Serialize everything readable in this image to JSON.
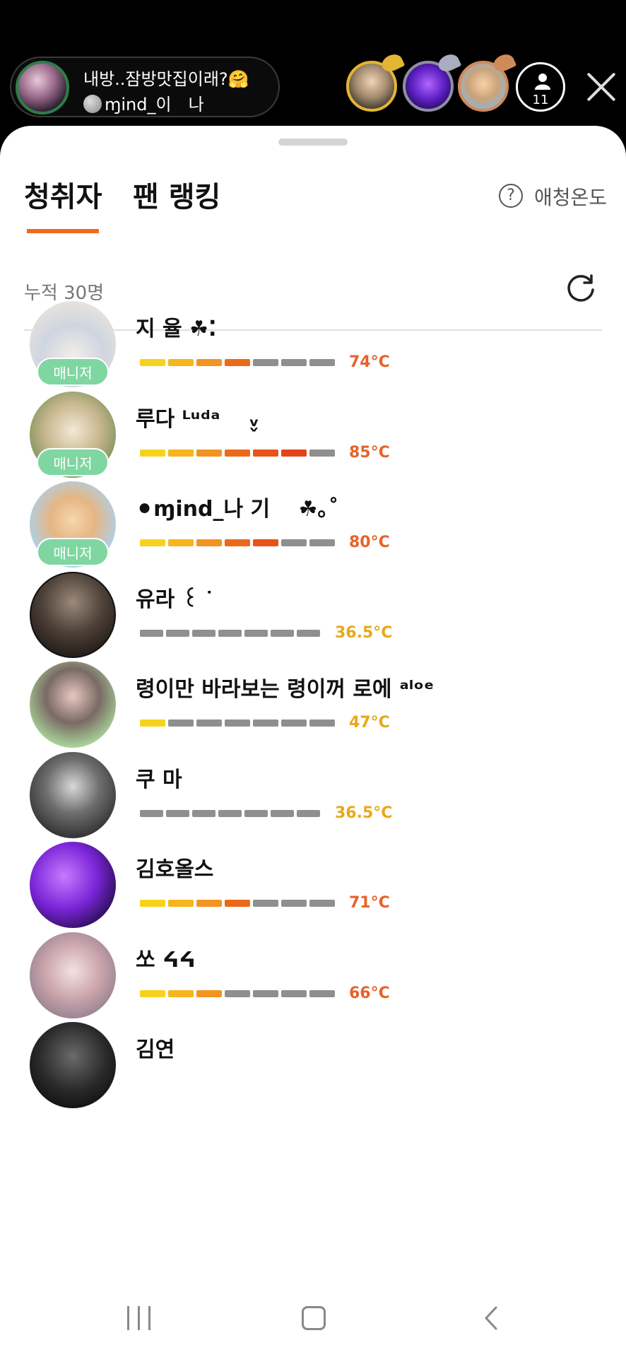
{
  "room": {
    "title": "내방..잠방맛집이래?🤗",
    "host": "ɱind_이　나"
  },
  "listener_count": "11",
  "tabs": [
    {
      "label": "청취자",
      "active": true
    },
    {
      "label": "팬 랭킹",
      "active": false
    }
  ],
  "help_label": "애청온도",
  "total_listeners": "누적 30명",
  "colors": {
    "accent": "#ee6a1d",
    "manager_badge": "#7fd6a1",
    "hot": "#e8622a",
    "warm": "#e8a81a"
  },
  "listeners": [
    {
      "name": "지 율 ☘︎⁚",
      "badge": "매니저",
      "temp": "74°C",
      "level": 0.74
    },
    {
      "name": "루다 ᴸᵘᵈᵃ　 ᵥ̬",
      "badge": "매니저",
      "temp": "85°C",
      "level": 0.85
    },
    {
      "name": "⚫ɱind_나 기　 ☘︎｡˚",
      "badge": "매니저",
      "temp": "80°C",
      "level": 0.8
    },
    {
      "name": "유라 ꒰ ᐝ",
      "badge": "",
      "temp": "36.5°C",
      "level": 0.365
    },
    {
      "name": "령이만 바라보는 령이꺼 로에 ᵃˡᵒᵉ",
      "badge": "",
      "temp": "47°C",
      "level": 0.47
    },
    {
      "name": "쿠 마",
      "badge": "",
      "temp": "36.5°C",
      "level": 0.365
    },
    {
      "name": "김호올스",
      "badge": "",
      "temp": "71°C",
      "level": 0.71
    },
    {
      "name": "쏘 ᔦᔦ",
      "badge": "",
      "temp": "66°C",
      "level": 0.66
    },
    {
      "name": "김연",
      "badge": "",
      "temp": "",
      "level": null
    }
  ]
}
